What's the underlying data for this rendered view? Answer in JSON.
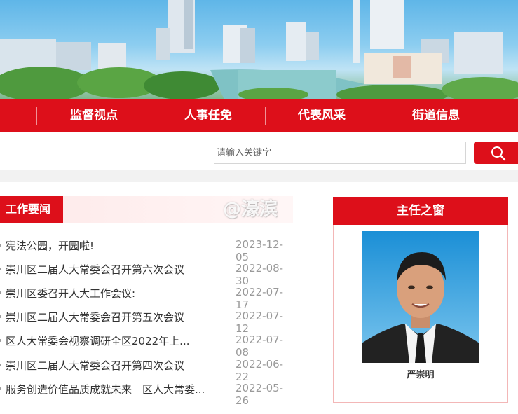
{
  "nav": {
    "items": [
      {
        "label": "监督视点"
      },
      {
        "label": "人事任免"
      },
      {
        "label": "代表风采"
      },
      {
        "label": "街道信息"
      }
    ]
  },
  "search": {
    "placeholder": "请输入关键字"
  },
  "news": {
    "heading": "工作要闻",
    "items": [
      {
        "title": "宪法公园，开园啦!",
        "date": "2023-12-05"
      },
      {
        "title": "崇川区二届人大常委会召开第六次会议",
        "date": "2022-08-30"
      },
      {
        "title": "崇川区委召开人大工作会议:",
        "date": "2022-07-17"
      },
      {
        "title": "崇川区二届人大常委会召开第五次会议",
        "date": "2022-07-12"
      },
      {
        "title": "区人大常委会视察调研全区2022年上...",
        "date": "2022-07-08"
      },
      {
        "title": "崇川区二届人大常委会召开第四次会议",
        "date": "2022-06-22"
      },
      {
        "title": "服务创造价值品质成就未来｜区人大常委...",
        "date": "2022-05-26"
      }
    ]
  },
  "watermark": "@濠滨",
  "director": {
    "heading": "主任之窗",
    "name": "严崇明"
  },
  "colors": {
    "brand_red": "#dd0f1a",
    "date_gray": "#999999"
  }
}
